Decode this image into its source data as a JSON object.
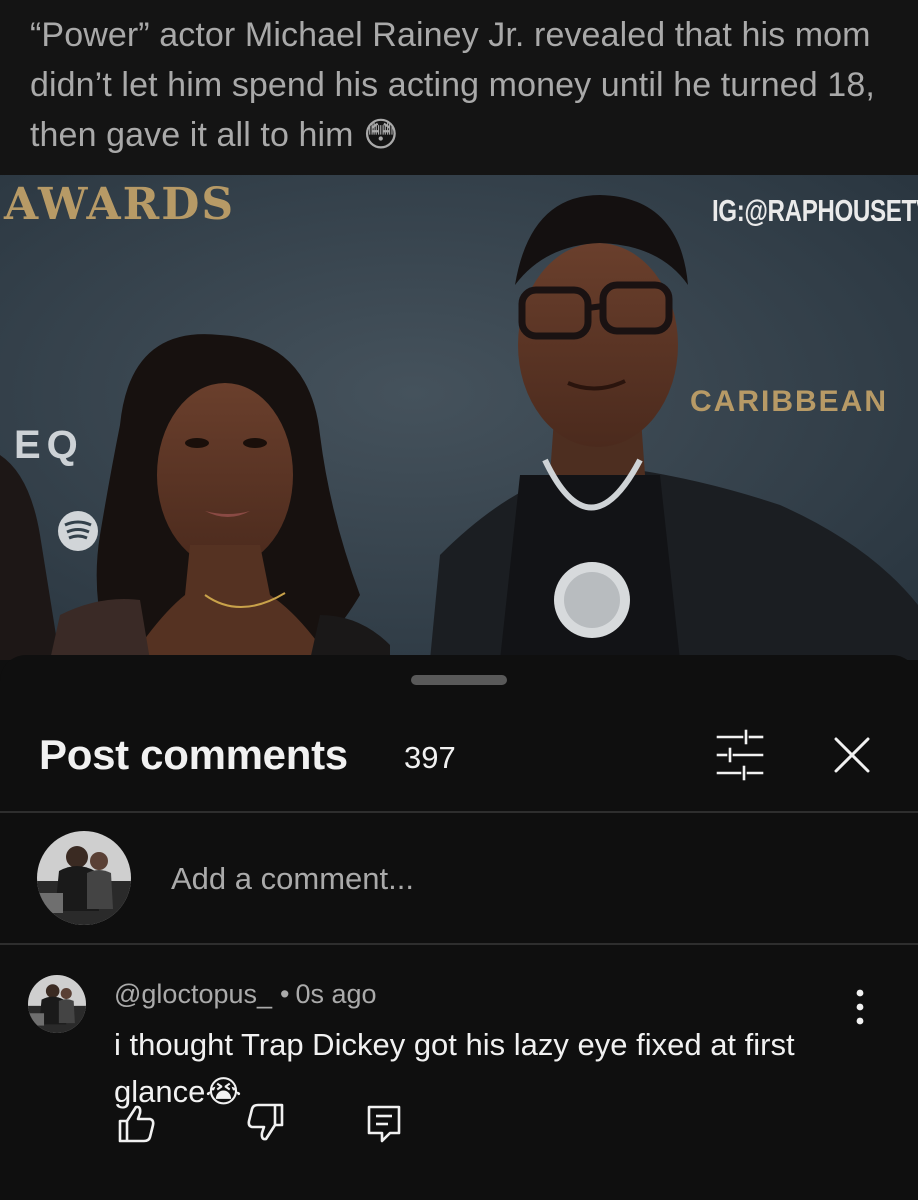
{
  "post": {
    "caption": "“Power” actor Michael Rainey Jr. revealed that his mom didn’t let him spend his acting money until he turned 18, then gave it all to him 😳",
    "image": {
      "backdrop_text_left": "AWARDS",
      "watermark": "IG:@RAPHOUSETV",
      "backdrop_text_right": "CARIBBEAN",
      "backdrop_text_eq": "EQ"
    }
  },
  "comments_sheet": {
    "title": "Post comments",
    "count": "397",
    "add_comment_placeholder": "Add a comment...",
    "comment": {
      "author": "@gloctopus_",
      "separator": "•",
      "time": "0s ago",
      "text": "i thought Trap Dickey got his lazy eye fixed at first glance😭"
    }
  },
  "icons": {
    "filter": "filter-sliders-icon",
    "close": "close-icon",
    "more": "more-vert-icon",
    "like": "thumbs-up-icon",
    "dislike": "thumbs-down-icon",
    "reply": "reply-comment-icon"
  },
  "colors": {
    "background": "#0f0f0f",
    "caption_text": "#a9a9a9",
    "primary_text": "#f1f1f1",
    "secondary_text": "#aaaaaa",
    "divider": "#2e2e2e"
  }
}
